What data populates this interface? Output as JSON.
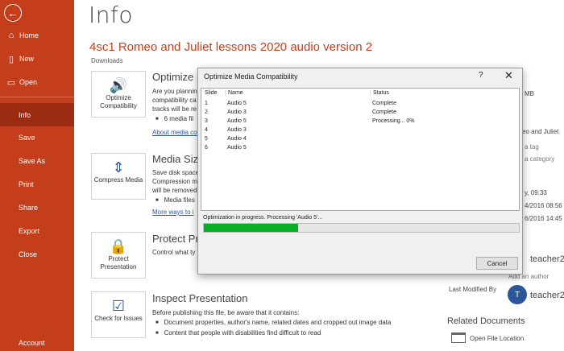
{
  "sidebar": {
    "back_icon": "arrow-left-icon",
    "items": [
      {
        "label": "Home",
        "icon": "home-icon"
      },
      {
        "label": "New",
        "icon": "new-document-icon"
      },
      {
        "label": "Open",
        "icon": "folder-open-icon"
      },
      {
        "label": "Info"
      },
      {
        "label": "Save"
      },
      {
        "label": "Save As"
      },
      {
        "label": "Print"
      },
      {
        "label": "Share"
      },
      {
        "label": "Export"
      },
      {
        "label": "Close"
      },
      {
        "label": "Account"
      }
    ],
    "active": "Info",
    "color": "#c43e1c",
    "active_color": "#9b2c12"
  },
  "page": {
    "title": "Info",
    "doc_title": "4sc1 Romeo and Juliet lessons 2020 audio version 2",
    "doc_path": "Downloads"
  },
  "sections": {
    "optimize": {
      "tile_label": "Optimize Compatibility",
      "title": "Optimize",
      "text1": "Are you plannin",
      "text2": "compatibility ca",
      "text3": "tracks will be re",
      "bullet1": "6 media fil",
      "link": "About media co"
    },
    "compress": {
      "tile_label": "Compress Media",
      "title": "Media Size",
      "text1": "Save disk space",
      "text2": "Compression m",
      "text3": "will be removed",
      "bullet1": "Media files",
      "link": "More ways to i"
    },
    "protect": {
      "tile_label": "Protect Presentation",
      "title": "Protect Pr",
      "text1": "Control what ty"
    },
    "inspect": {
      "tile_label": "Check for Issues",
      "title": "Inspect Presentation",
      "text1": "Before publishing this file, be aware that it contains:",
      "bullet1": "Document properties, author's name, related dates and cropped out image data",
      "bullet2": "Content that people with disabilities find difficult to read"
    }
  },
  "properties": {
    "size_fragment": "MB",
    "title_fragment": "eo and Juliet",
    "tags_fragment": "a tag",
    "category_fragment": "a category",
    "modified_fragment": "y, 09:33",
    "created_fragment": "4/2016 08:56",
    "printed_fragment": "6/2016 14:45",
    "author_name": "teacher2",
    "add_author": "Add an author",
    "last_modified_label": "Last Modified By",
    "last_modified_initial": "T",
    "last_modified_name": "teacher2",
    "related_title": "Related Documents",
    "open_location": "Open File Location"
  },
  "dialog": {
    "title": "Optimize Media Compatibility",
    "help": "?",
    "close": "✕",
    "columns": [
      "Slide",
      "Name",
      "Status"
    ],
    "rows": [
      {
        "slide": "1",
        "name": "Audio 5",
        "status": "Complete"
      },
      {
        "slide": "2",
        "name": "Audio 3",
        "status": "Complete"
      },
      {
        "slide": "3",
        "name": "Audio 5",
        "status": "Processing... 0%"
      },
      {
        "slide": "4",
        "name": "Audio 3",
        "status": ""
      },
      {
        "slide": "5",
        "name": "Audio 4",
        "status": ""
      },
      {
        "slide": "6",
        "name": "Audio 5",
        "status": ""
      }
    ],
    "status_text": "Optimization in progress. Processing 'Audio 5'...",
    "progress_fraction": 0.3,
    "progress_color": "#06b025",
    "cancel_label": "Cancel"
  }
}
